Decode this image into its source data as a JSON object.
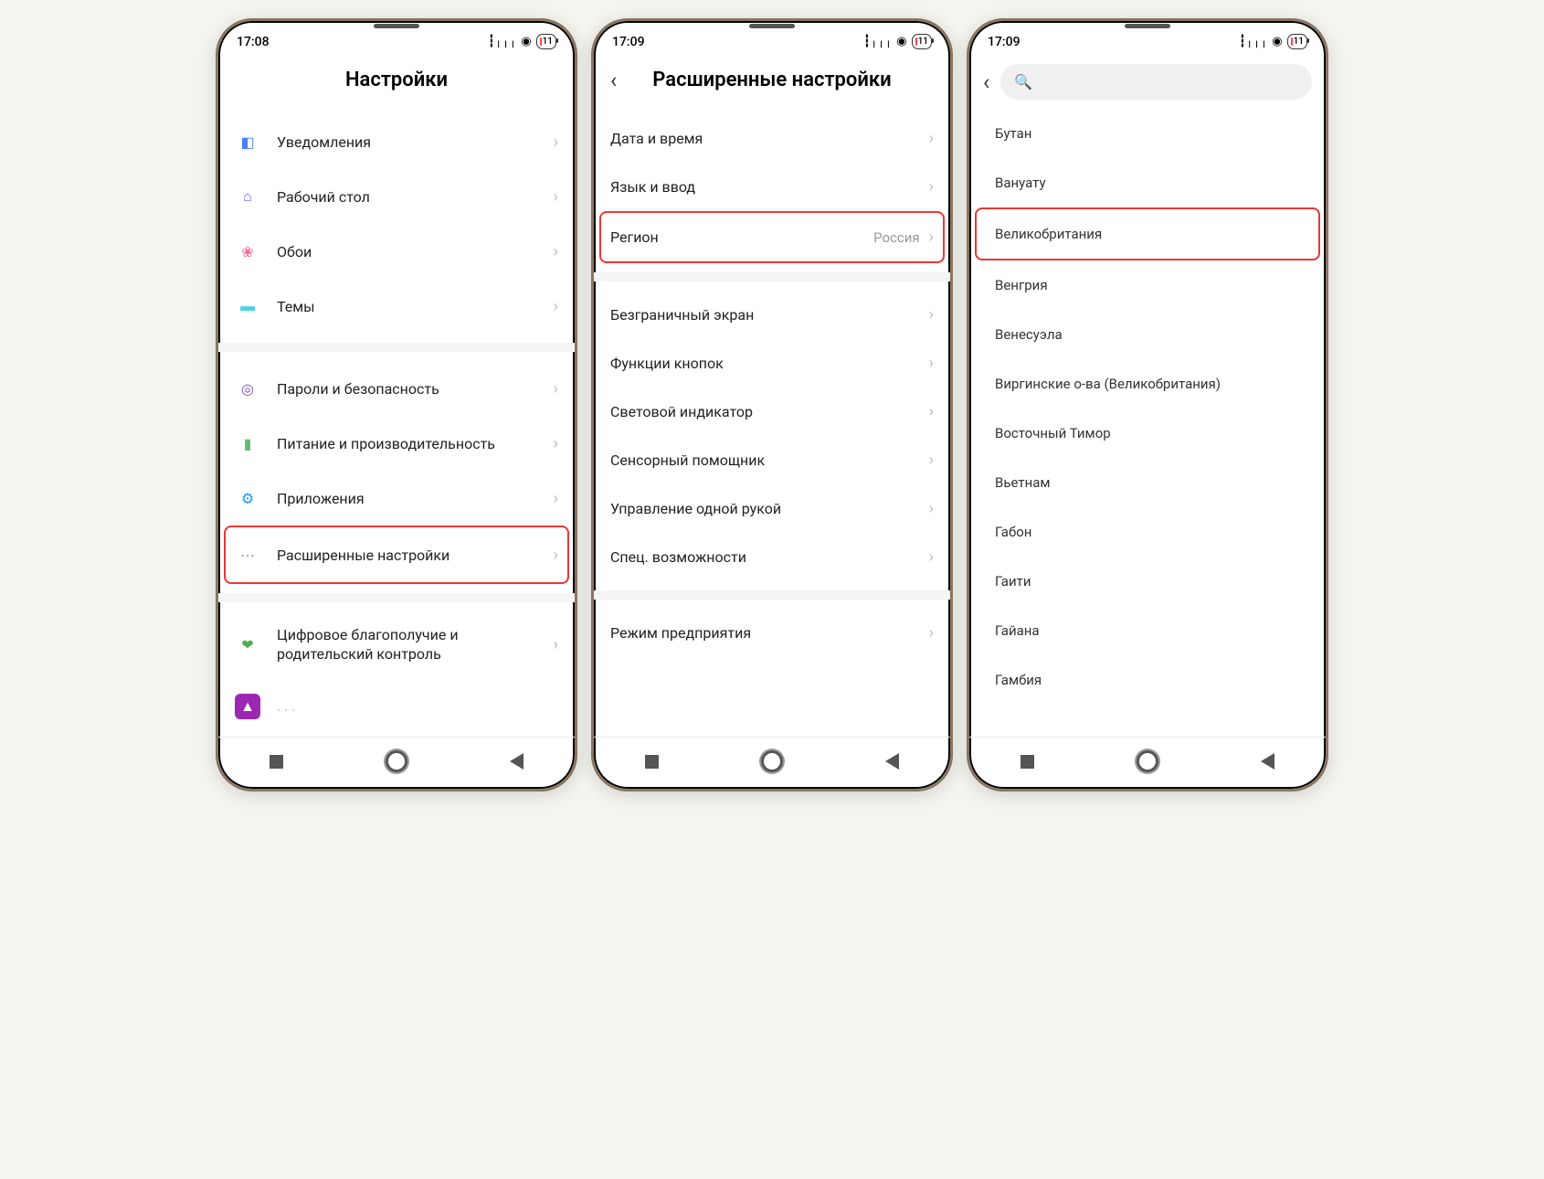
{
  "status": {
    "time1": "17:08",
    "time2": "17:09",
    "time3": "17:09",
    "battery": "11"
  },
  "screen1": {
    "title": "Настройки",
    "items": [
      {
        "label": "Уведомления",
        "icon_color": "#4a7fff"
      },
      {
        "label": "Рабочий стол",
        "icon_color": "#6b5eff"
      },
      {
        "label": "Обои",
        "icon_color": "#ff6b9a"
      },
      {
        "label": "Темы",
        "icon_color": "#4dd0e1"
      }
    ],
    "items2": [
      {
        "label": "Пароли и безопасность",
        "icon_color": "#7e57c2"
      },
      {
        "label": "Питание и производительность",
        "icon_color": "#66bb6a"
      },
      {
        "label": "Приложения",
        "icon_color": "#2196f3"
      },
      {
        "label": "Расширенные настройки",
        "icon_color": "#90a4ae",
        "highlight": true
      }
    ],
    "items3": [
      {
        "label": "Цифровое благополучие и родительский контроль",
        "icon_color": "#4caf50"
      }
    ]
  },
  "screen2": {
    "title": "Расширенные настройки",
    "items": [
      {
        "label": "Дата и время"
      },
      {
        "label": "Язык и ввод"
      },
      {
        "label": "Регион",
        "value": "Россия",
        "highlight": true
      }
    ],
    "items2": [
      {
        "label": "Безграничный экран"
      },
      {
        "label": "Функции кнопок"
      },
      {
        "label": "Световой индикатор"
      },
      {
        "label": "Сенсорный помощник"
      },
      {
        "label": "Управление одной рукой"
      },
      {
        "label": "Спец. возможности"
      }
    ],
    "items3": [
      {
        "label": "Режим предприятия"
      }
    ]
  },
  "screen3": {
    "countries": [
      {
        "label": "Бутан"
      },
      {
        "label": "Вануату"
      },
      {
        "label": "Великобритания",
        "highlight": true
      },
      {
        "label": "Венгрия"
      },
      {
        "label": "Венесуэла"
      },
      {
        "label": "Виргинские о-ва (Великобритания)"
      },
      {
        "label": "Восточный Тимор"
      },
      {
        "label": "Вьетнам"
      },
      {
        "label": "Габон"
      },
      {
        "label": "Гаити"
      },
      {
        "label": "Гайана"
      },
      {
        "label": "Гамбия"
      }
    ]
  }
}
